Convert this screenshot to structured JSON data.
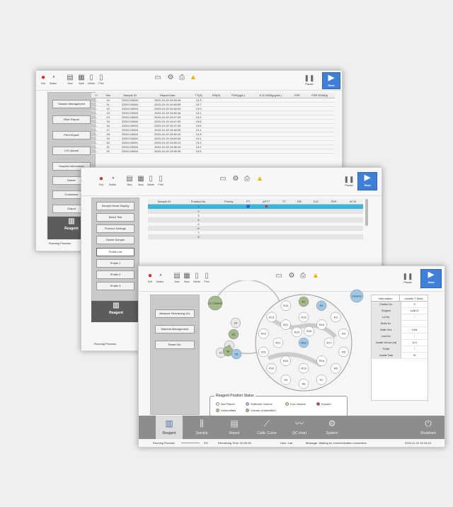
{
  "toolbar": {
    "exit": "Exit",
    "switch": "Switch",
    "new": "New",
    "save": "Save",
    "delete": "Delete",
    "print": "Print",
    "pause": "Pause",
    "start": "Start",
    "warn": "Alert"
  },
  "window1": {
    "side_buttons": [
      "Sample Management",
      "Filter Report",
      "Print Report",
      "LIS Upload",
      "Hospital Information",
      "Delete",
      "Customize",
      "Output"
    ],
    "nav_tab": "Reagent",
    "status": "Running Process:",
    "columns": [
      "Sex",
      "Sample ID",
      "Report Date",
      "TT(S)",
      "FIB(S)",
      "FDP(μg/L)",
      "D-D DDM(μg/mL)",
      "FDP",
      "FDP DDM(s)"
    ],
    "rows": [
      [
        "10",
        "2201C19003",
        "2022-10-19 10:45:40",
        "13.3"
      ],
      [
        "11",
        "2201C19003",
        "2022-10-19 10:46:50",
        "13.7"
      ],
      [
        "12",
        "2201C19003",
        "2022-10-19 10:46:00",
        "13.0"
      ],
      [
        "13",
        "2201C19003",
        "2022-10-19 10:46:40",
        "13.1"
      ],
      [
        "14",
        "2201C19003",
        "2022-10-19 10:47:00",
        "13.2"
      ],
      [
        "15",
        "2201C19003",
        "2022-10-19 10:47:20",
        "13.8"
      ],
      [
        "16",
        "2201C19003",
        "2022-10-19 10:47:45",
        "13.6"
      ],
      [
        "17",
        "2201C19003",
        "2022-10-19 10:48:00",
        "13.1"
      ],
      [
        "18",
        "2201C19004",
        "2022-10-19 10:54:10",
        "13.3"
      ],
      [
        "19",
        "2201C19004",
        "2022-10-19 10:54:30",
        "13.1"
      ],
      [
        "20",
        "2201C19001",
        "2022-10-19 10:55:10",
        "13.1"
      ],
      [
        "21",
        "2201C19004",
        "2022-10-19 10:55:10",
        "13.2"
      ],
      [
        "22",
        "2201C19004",
        "2022-10-19 10:55:30",
        "13.5"
      ]
    ]
  },
  "window2": {
    "side_buttons": [
      "Sample Mode Display",
      "Batch Test",
      "Protocol Settings",
      "Delete Sample",
      "Profile List",
      "Profile 1",
      "Profile 2",
      "Profile 3"
    ],
    "nav_tab": "Reagent",
    "status": "Running Process:",
    "columns": [
      "Sample ID",
      "Position No.",
      "Priority",
      "PT",
      "APTT",
      "TT",
      "FIB",
      "D-D",
      "FDP",
      "AT-III"
    ],
    "positions": [
      "1",
      "2",
      "3",
      "4",
      "5",
      "6",
      "7",
      "8"
    ]
  },
  "window3": {
    "side_buttons": [
      "Measure Remaining Vol.",
      "Material Management",
      "Reset Vol."
    ],
    "legend_title": "Reagent Position Status",
    "legend": [
      {
        "label": "Not Placed",
        "color": "#ffffff"
      },
      {
        "label": "Sufficient Volume",
        "color": "#9fc7e8"
      },
      {
        "label": "Low Volume",
        "color": "#f2d48a"
      },
      {
        "label": "Expired",
        "color": "#e0262d"
      },
      {
        "label": "Unidentified",
        "color": "#e8b36a"
      },
      {
        "label": "Volume Unidentified",
        "color": "#a3b98a"
      }
    ],
    "info_tabs": [
      "Information",
      "Usable T.Tests"
    ],
    "info_rows": [
      {
        "k": "Position No.",
        "v": "S"
      },
      {
        "k": "Reagent",
        "v": "Audit ID"
      },
      {
        "k": "Lot No.",
        "v": "/"
      },
      {
        "k": "Bottle No.",
        "v": ""
      },
      {
        "k": "Bottle Size",
        "v": "10ml"
      },
      {
        "k": "Loss/Vol.",
        "v": "/"
      },
      {
        "k": "Usable Volume (ml)",
        "v": "10.0"
      },
      {
        "k": "Profile",
        "v": "/"
      },
      {
        "k": "Usable Tests",
        "v": "33"
      }
    ],
    "tray_outer_labels": [
      "C1\nCleaner",
      "04",
      "03",
      "02",
      "01",
      "06",
      "05"
    ],
    "tray_inner_labels": [
      "R1",
      "R2",
      "R3",
      "R4",
      "R5",
      "R6",
      "R7",
      "R8",
      "R9",
      "R10",
      "R11",
      "R12",
      "R13",
      "R14",
      "R15",
      "R16",
      "R17",
      "R18",
      "R19",
      "R20",
      "R21",
      "R22",
      "R23",
      "R24",
      "R25"
    ],
    "cleaner_label": "Cleaner",
    "nav": [
      "Reagent",
      "Sample",
      "Report",
      "Calib. Curve",
      "QC chart",
      "System",
      "Shutdown"
    ],
    "status": {
      "running": "Running Process:",
      "percent": "0%",
      "remaining": "Remaining Time: 00:00:00",
      "user": "User: Lab",
      "message": "Message: Waiting for communication connection",
      "datetime": "2022-11-22 16:10:43"
    }
  }
}
